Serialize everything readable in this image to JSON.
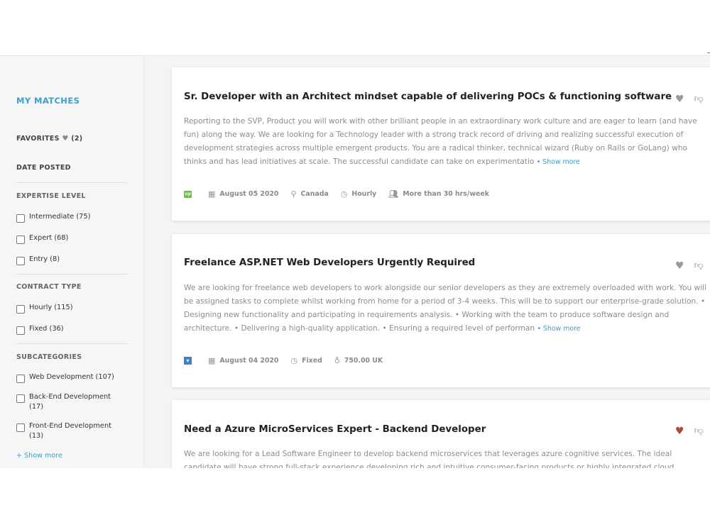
{
  "sidebar": {
    "title": "MY MATCHES",
    "favorites": {
      "label": "FAVORITES",
      "count": "(2)"
    },
    "date_posted": "DATE POSTED",
    "expertise": {
      "heading": "EXPERTISE LEVEL",
      "options": [
        {
          "label": "Intermediate (75)"
        },
        {
          "label": "Expert (68)"
        },
        {
          "label": "Entry (8)"
        }
      ]
    },
    "contract": {
      "heading": "CONTRACT TYPE",
      "options": [
        {
          "label": "Hourly (115)"
        },
        {
          "label": "Fixed (36)"
        }
      ]
    },
    "subcategories": {
      "heading": "SUBCATEGORIES",
      "options": [
        {
          "label": "Web Development (107)"
        },
        {
          "label": "Back-End Development (17)"
        },
        {
          "label": "Front-End Development (13)"
        }
      ],
      "show_more": "+ Show more"
    }
  },
  "jobs": [
    {
      "title": "Sr. Developer with an Architect mindset capable of delivering POCs & functioning software",
      "description": "Reporting to the SVP, Product you will work with other brilliant people in an extraordinary work culture and are eager to learn (and have fun) along the way. We are looking for a Technology leader with a strong track record of driving and realizing successful execution of development strategies across multiple emergent products. You are a radical thinker, technical wizard (Ruby on Rails or GoLang) who thinks and has lead initiatives at scale. The successful candidate can take on experimentatio",
      "show_more": "• Show more",
      "source_badge": "up",
      "date": "August 05 2020",
      "location": "Canada",
      "contract": "Hourly",
      "workload": "More than 30 hrs/week",
      "favorited": false
    },
    {
      "title": "Freelance ASP.NET Web Developers Urgently Required",
      "description": "We are looking for freelance web developers to work alongside our senior developers as they are extremely overloaded with work. You will be assigned tasks to complete whilst working from home for a period of 3-4 weeks. This will be to support our enterprise-grade solution. • Designing new functionality and participating in requirements analysis. • Working with the team to produce software design and architecture. • Delivering a high-quality application. • Ensuring a required level of performan",
      "show_more": "• Show more",
      "date": "August 04 2020",
      "contract": "Fixed",
      "budget": "750.00 UK",
      "favorited": false
    },
    {
      "title": "Need a Azure MicroServices Expert - Backend Developer",
      "description": "We are looking for a Lead Software Engineer to develop backend microservices that leverages azure cognitive services. The ideal candidate will have strong full-stack experience developing rich and intuitive consumer-facing products or highly integrated cloud",
      "favorited": true
    }
  ],
  "icons": {
    "favorite": "heart-icon",
    "dislike": "thumbs-down-icon",
    "date": "calendar-icon",
    "location": "map-pin-icon",
    "contract": "clock-icon",
    "workload": "users-icon",
    "budget": "money-bag-icon"
  },
  "colors": {
    "accent": "#3aa0d3",
    "favorite_active": "#b0473b",
    "upwork_badge": "#6fbe44",
    "source_badge_blue": "#3a82c7"
  }
}
